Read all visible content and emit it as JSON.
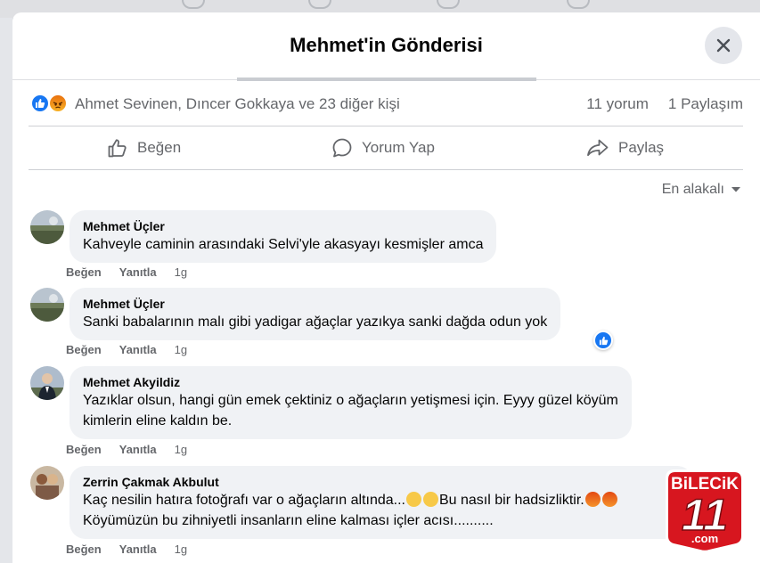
{
  "modal": {
    "title": "Mehmet'in Gönderisi"
  },
  "reactions": {
    "names": "Ahmet Sevinen, Dıncer Gokkaya ve 23 diğer kişi",
    "comments_count": "11 yorum",
    "shares_count": "1 Paylaşım"
  },
  "actions": {
    "like": "Beğen",
    "comment": "Yorum Yap",
    "share": "Paylaş"
  },
  "sort": {
    "label": "En alakalı"
  },
  "comments": [
    {
      "author": "Mehmet Üçler",
      "lines": [
        "Kahveyle caminin arasındaki Selvi'yle akasyayı kesmişler amca"
      ],
      "like": "Beğen",
      "reply": "Yanıtla",
      "time": "1g"
    },
    {
      "author": "Mehmet Üçler",
      "lines": [
        "Sanki babalarının malı gibi yadigar ağaçlar yazıkya sanki dağda odun yok"
      ],
      "like": "Beğen",
      "reply": "Yanıtla",
      "time": "1g"
    },
    {
      "author": "Mehmet Akyildiz",
      "lines": [
        "Yazıklar olsun, hangi gün emek çektiniz o ağaçların yetişmesi için. Eyyy güzel köyüm",
        "kimlerin eline kaldın be."
      ],
      "like": "Beğen",
      "reply": "Yanıtla",
      "time": "1g"
    },
    {
      "author": "Zerrin Çakmak Akbulut",
      "lines": [
        "Kaç nesilin hatıra fotoğrafı var o ağaçların altında...",
        "Bu nasıl bir hadsizliktir.",
        "Köyümüzün bu zihniyetli insanların eline kalması içler acısı.........."
      ],
      "like": "Beğen",
      "reply": "Yanıtla",
      "time": "1g"
    }
  ],
  "watermark": {
    "line1": "BiLECiK",
    "line2": "11",
    "line3": ".com"
  },
  "colors": {
    "accent": "#1877f2",
    "muted_text": "#65676b",
    "bubble_bg": "#f0f2f5",
    "logo_red": "#d7161f"
  }
}
